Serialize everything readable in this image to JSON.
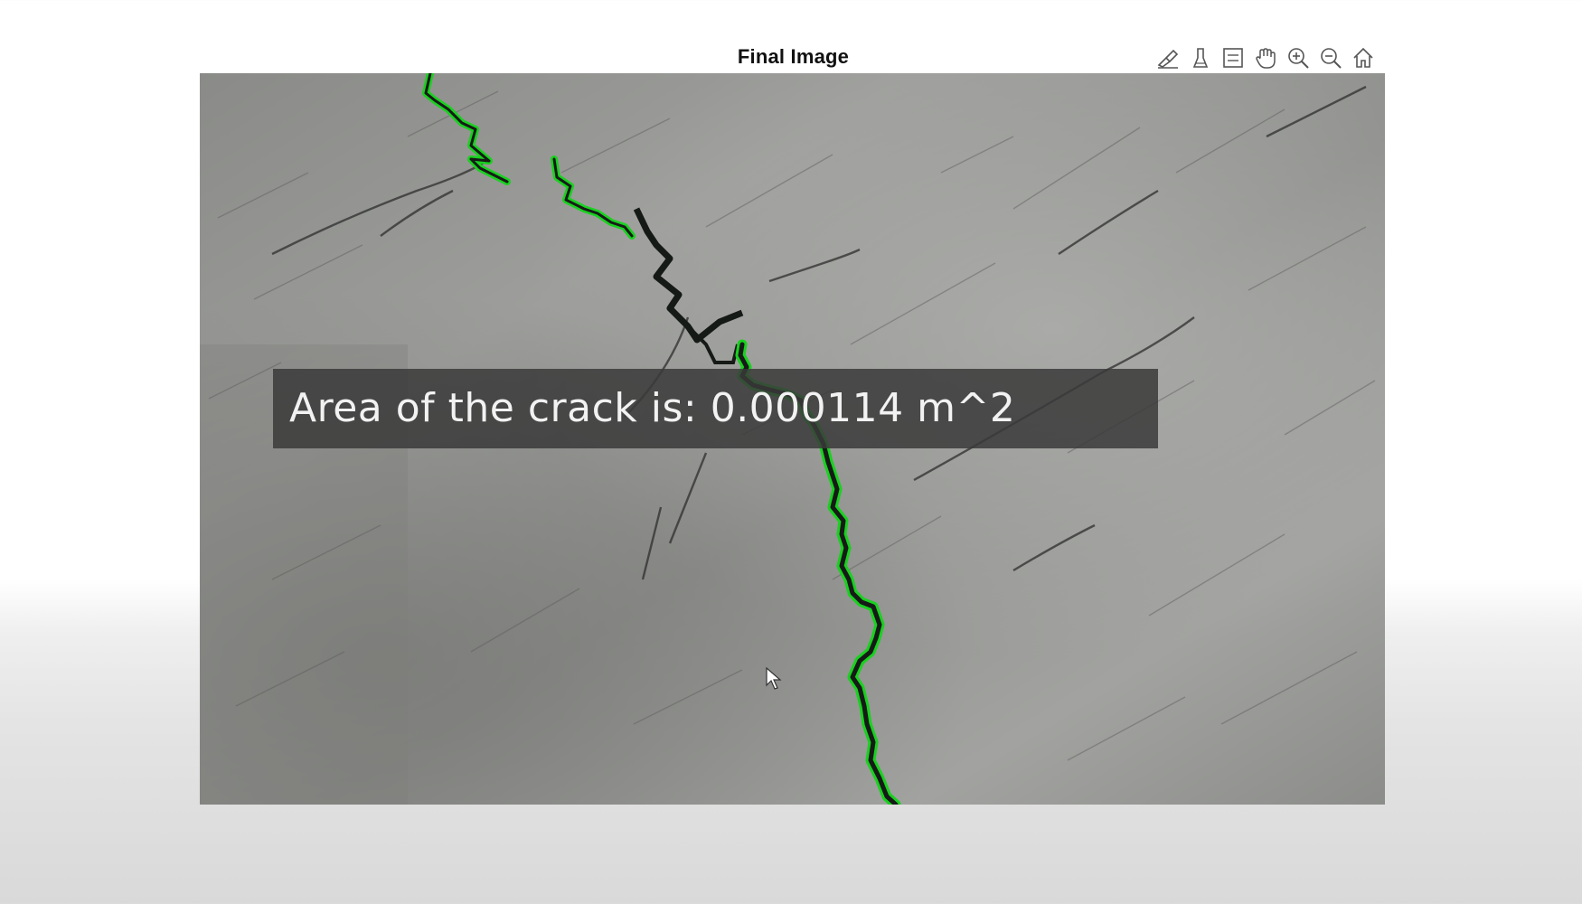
{
  "figure": {
    "title": "Final Image",
    "annotation_text": "Area of the crack is: 0.000114 m^2"
  },
  "toolbar": {
    "buttons": [
      {
        "icon": "brush-icon"
      },
      {
        "icon": "data-tips-icon"
      },
      {
        "icon": "legend-icon"
      },
      {
        "icon": "pan-hand-icon"
      },
      {
        "icon": "zoom-in-icon"
      },
      {
        "icon": "zoom-out-icon"
      },
      {
        "icon": "home-restore-view-icon"
      }
    ]
  },
  "colors": {
    "crack_outline": "#19d11f",
    "crack_fill": "#161a17",
    "concrete_base": "#8e8f8c",
    "annotation_bg": "#3a3a3a"
  }
}
